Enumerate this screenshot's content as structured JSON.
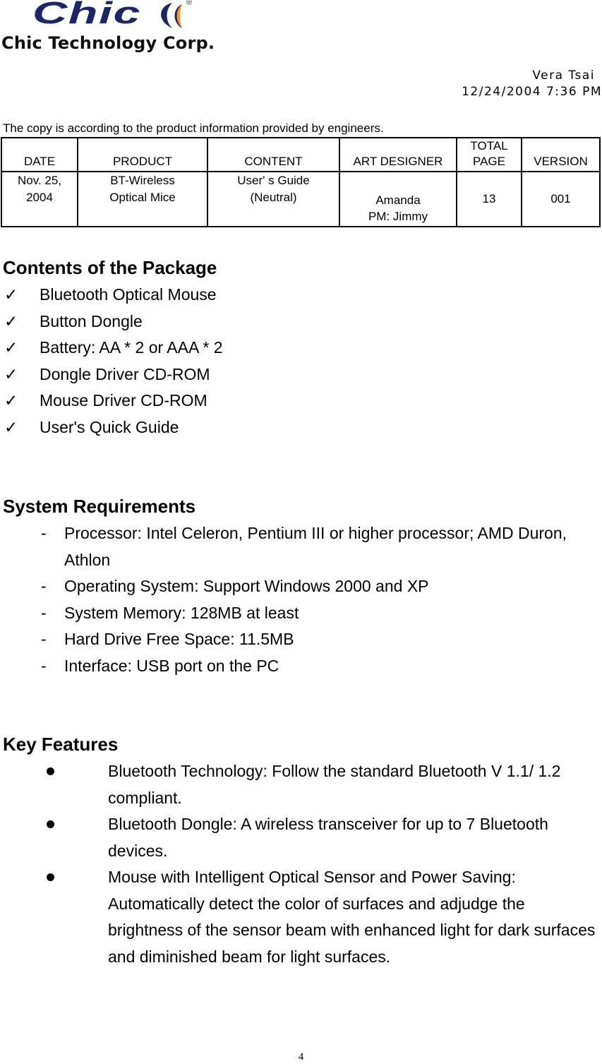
{
  "logo": {
    "brand": "Chic",
    "registered": "®",
    "company": "Chic Technology Corp.",
    "colors": {
      "navy": "#1c2566",
      "orange": "#f7931e"
    }
  },
  "header": {
    "author": "Vera Tsai",
    "timestamp": "12/24/2004 7:36 PM",
    "copy_note": "The copy is according to the product information provided by engineers."
  },
  "info_table": {
    "columns": [
      "DATE",
      "PRODUCT",
      "CONTENT",
      "ART DESIGNER",
      "TOTAL PAGE",
      "VERSION"
    ],
    "total_page_lines": [
      "TOTAL",
      "PAGE"
    ],
    "row": {
      "date": [
        "Nov. 25,",
        "2004"
      ],
      "product": [
        "BT-Wireless",
        "Optical Mice"
      ],
      "content": [
        "User' s Guide",
        "(Neutral)"
      ],
      "art_designer": [
        "Amanda",
        "PM: Jimmy"
      ],
      "total_page": "13",
      "version": "001"
    }
  },
  "package": {
    "title": "Contents of the Package",
    "icon": "check-icon",
    "items": [
      "Bluetooth Optical Mouse",
      "Button Dongle",
      "Battery: AA * 2 or AAA * 2",
      "Dongle Driver CD-ROM",
      "Mouse Driver CD-ROM",
      "User's Quick Guide"
    ]
  },
  "requirements": {
    "title": "System Requirements",
    "bullet": "-",
    "items": [
      "Processor: Intel Celeron, Pentium III or higher processor; AMD Duron, Athlon",
      "Operating System: Support Windows 2000 and XP",
      "System Memory: 128MB at least",
      "Hard Drive Free Space: 11.5MB",
      "Interface: USB port on the PC"
    ]
  },
  "features": {
    "title": "Key Features",
    "items": [
      "Bluetooth Technology: Follow the standard Bluetooth V 1.1/ 1.2 compliant.",
      "Bluetooth Dongle: A wireless transceiver for up to 7 Bluetooth devices.",
      "Mouse with Intelligent Optical Sensor and Power Saving: Automatically detect the color of surfaces and adjudge the brightness of the sensor beam with enhanced light for dark surfaces and diminished beam for light surfaces."
    ]
  },
  "footer": {
    "page_number": "4"
  }
}
